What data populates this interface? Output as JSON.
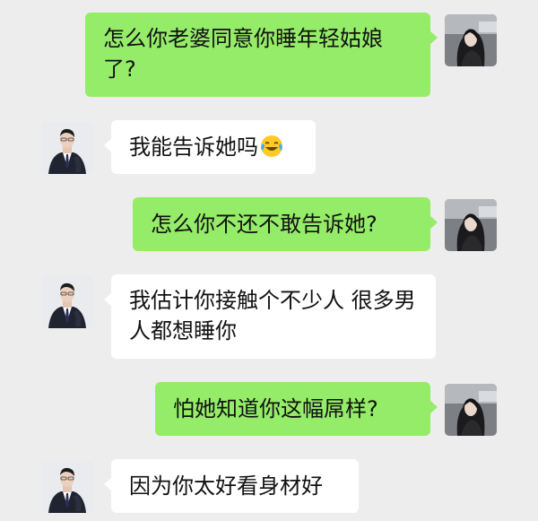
{
  "conversation": {
    "messages": [
      {
        "sender": "self",
        "text": "怎么你老婆同意你睡年轻姑娘了?"
      },
      {
        "sender": "other",
        "text": "我能告诉她吗",
        "emoji": "laughing-crying-emoji"
      },
      {
        "sender": "self",
        "text": "怎么你不还不敢告诉她?"
      },
      {
        "sender": "other",
        "text": "我估计你接触个不少人 很多男人都想睡你"
      },
      {
        "sender": "self",
        "text": "怕她知道你这幅屌样?"
      },
      {
        "sender": "other",
        "text": "因为你太好看身材好"
      }
    ]
  },
  "avatars": {
    "self": "avatar-girl-photo",
    "other": "avatar-man-suit-photo"
  },
  "colors": {
    "background": "#ededed",
    "self_bubble": "#95ec69",
    "other_bubble": "#ffffff"
  }
}
